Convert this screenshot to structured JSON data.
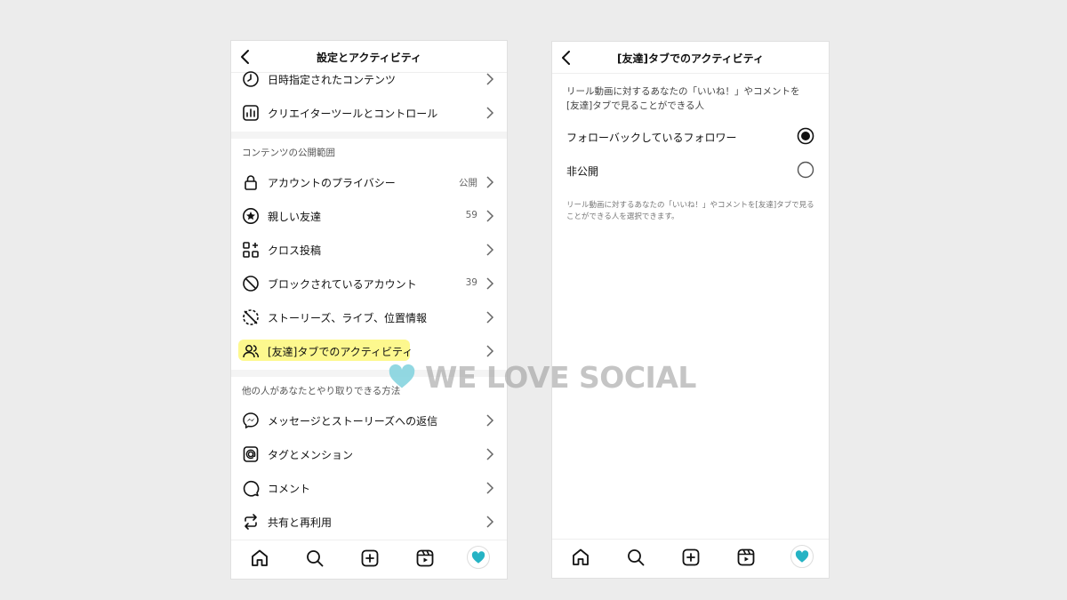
{
  "colors": {
    "highlight": "#fdf77a",
    "watermark_heart": "#7fd1dd",
    "avatar_heart": "#25b3c4"
  },
  "left": {
    "title": "設定とアクティビティ",
    "items_top": [
      {
        "label": "日時指定されたコンテンツ",
        "icon": "clock-icon"
      },
      {
        "label": "クリエイターツールとコントロール",
        "icon": "bar-chart-icon"
      }
    ],
    "section1": "コンテンツの公開範囲",
    "items_visibility": [
      {
        "label": "アカウントのプライバシー",
        "meta": "公開",
        "icon": "lock-icon"
      },
      {
        "label": "親しい友達",
        "meta": "59",
        "icon": "star-circle-icon"
      },
      {
        "label": "クロス投稿",
        "meta": "",
        "icon": "grid-plus-icon"
      },
      {
        "label": "ブロックされているアカウント",
        "meta": "39",
        "icon": "block-icon"
      },
      {
        "label": "ストーリーズ、ライブ、位置情報",
        "meta": "",
        "icon": "story-off-icon"
      },
      {
        "label": "[友達]タブでのアクティビティ",
        "meta": "",
        "icon": "people-icon"
      }
    ],
    "section2": "他の人があなたとやり取りできる方法",
    "items_interaction": [
      {
        "label": "メッセージとストーリーズへの返信",
        "icon": "messenger-icon"
      },
      {
        "label": "タグとメンション",
        "icon": "at-icon"
      },
      {
        "label": "コメント",
        "icon": "comment-icon"
      },
      {
        "label": "共有と再利用",
        "icon": "repost-icon"
      }
    ]
  },
  "right": {
    "title": "[友達]タブでのアクティビティ",
    "description": "リール動画に対するあなたの「いいね！」やコメントを[友達]タブで見ることができる人",
    "options": [
      {
        "label": "フォローバックしているフォロワー",
        "selected": true
      },
      {
        "label": "非公開",
        "selected": false
      }
    ],
    "note": "リール動画に対するあなたの「いいね！」やコメントを[友達]タブで見ることができる人を選択できます。"
  },
  "watermark": {
    "text": "WE LOVE SOCIAL"
  }
}
